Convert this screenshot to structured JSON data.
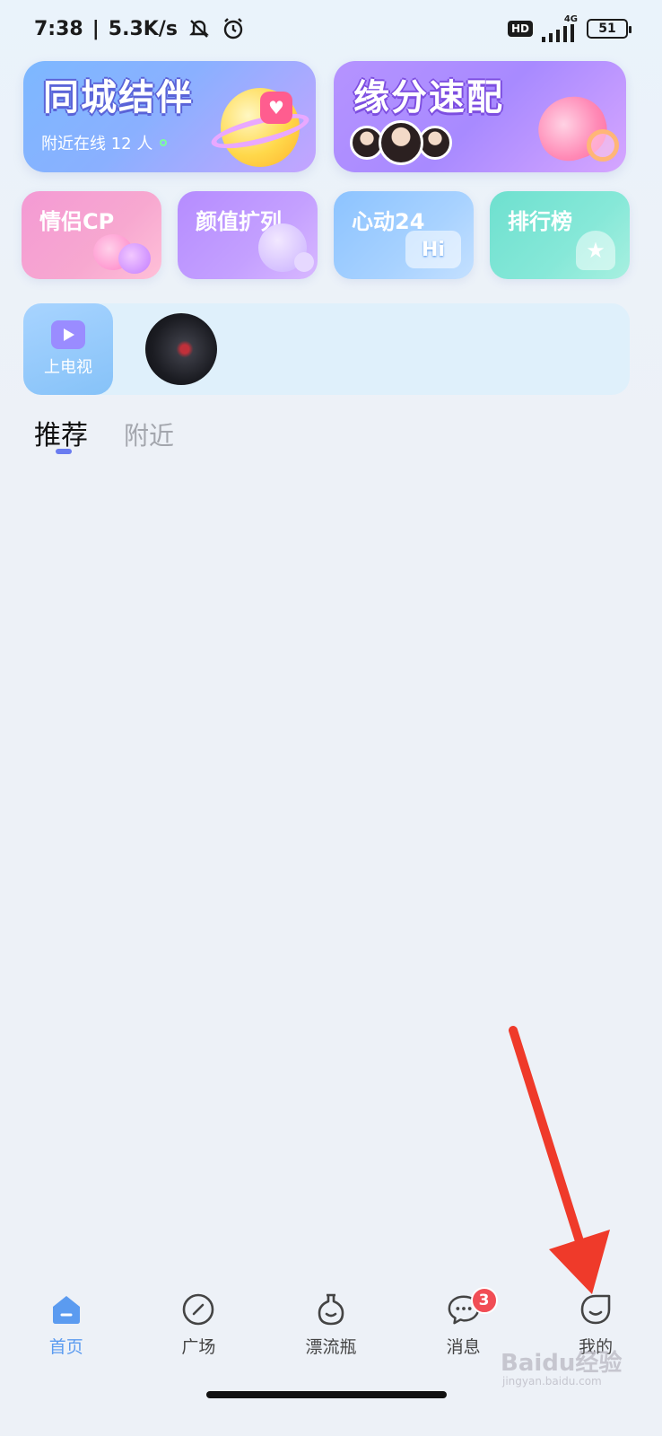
{
  "status_bar": {
    "time": "7:38",
    "separator": "|",
    "network_speed": "5.3K/s",
    "hd_label": "HD",
    "signal_label": "4G",
    "battery": "51",
    "icons": [
      "mute-icon",
      "alarm-icon",
      "signal-icon"
    ]
  },
  "feature_cards": {
    "city": {
      "title": "同城结伴",
      "online": "附近在线 12 人"
    },
    "match": {
      "title": "缘分速配"
    }
  },
  "tiles": [
    {
      "label": "情侣CP"
    },
    {
      "label": "颜值扩列"
    },
    {
      "label": "心动24",
      "deco": "Hi"
    },
    {
      "label": "排行榜"
    }
  ],
  "tv_strip": {
    "label": "上电视"
  },
  "tabs": [
    {
      "label": "推荐",
      "active": true
    },
    {
      "label": "附近",
      "active": false
    }
  ],
  "bottom_nav": [
    {
      "label": "首页",
      "icon": "home-icon",
      "active": true
    },
    {
      "label": "广场",
      "icon": "compass-icon",
      "active": false
    },
    {
      "label": "漂流瓶",
      "icon": "bottle-icon",
      "active": false
    },
    {
      "label": "消息",
      "icon": "chat-icon",
      "active": false,
      "badge": "3"
    },
    {
      "label": "我的",
      "icon": "profile-icon",
      "active": false
    }
  ],
  "watermark": {
    "text": "Baidu经验",
    "sub": "jingyan.baidu.com"
  },
  "colors": {
    "accent": "#5b9bf0",
    "badge": "#f14d55",
    "annotation_arrow": "#ef3a2a"
  }
}
